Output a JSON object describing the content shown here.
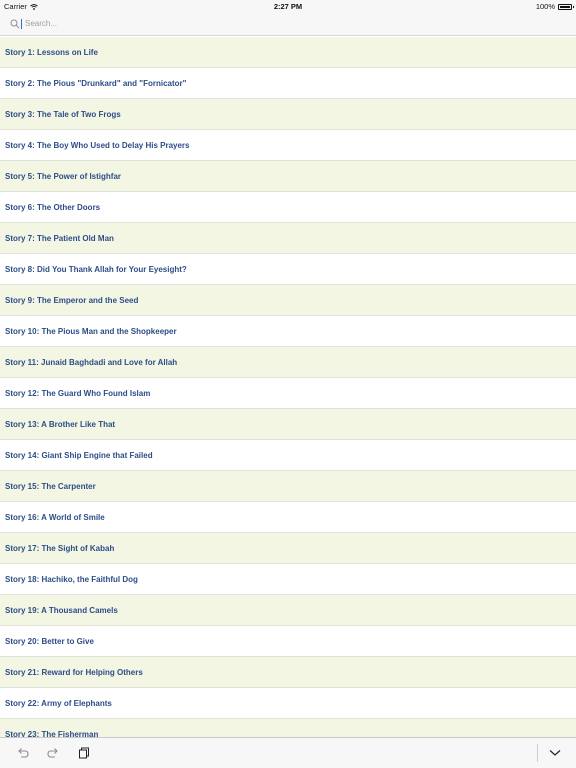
{
  "status_bar": {
    "carrier": "Carrier",
    "time": "2:27 PM",
    "battery": "100%"
  },
  "search": {
    "placeholder": "Search..."
  },
  "stories": [
    "Story 1: Lessons on Life",
    "Story 2: The Pious \"Drunkard\" and \"Fornicator\"",
    "Story 3: The Tale of Two Frogs",
    "Story 4: The Boy Who Used to Delay His Prayers",
    "Story 5: The Power of Istighfar",
    "Story 6: The Other Doors",
    "Story 7: The Patient Old Man",
    "Story 8: Did You Thank Allah for Your Eyesight?",
    "Story 9: The Emperor and the Seed",
    "Story 10: The Pious Man and the Shopkeeper",
    "Story 11: Junaid Baghdadi and Love for Allah",
    "Story 12: The Guard Who Found Islam",
    "Story 13: A Brother Like That",
    "Story 14: Giant Ship Engine that Failed",
    "Story 15: The Carpenter",
    "Story 16: A World of Smile",
    "Story 17: The Sight of Kabah",
    "Story 18: Hachiko, the Faithful Dog",
    "Story 19: A Thousand Camels",
    "Story 20: Better to Give",
    "Story 21: Reward for Helping Others",
    "Story 22: Army of Elephants",
    "Story 23: The Fisherman"
  ],
  "colors": {
    "row_text": "#2c4d87",
    "row_alt_bg": "#f4f6e4",
    "caret": "#2b6cd4"
  },
  "icons": {
    "toolbar": [
      "undo-icon",
      "redo-icon",
      "paste-icon",
      "chevron-down-icon"
    ],
    "search": "search-icon"
  }
}
